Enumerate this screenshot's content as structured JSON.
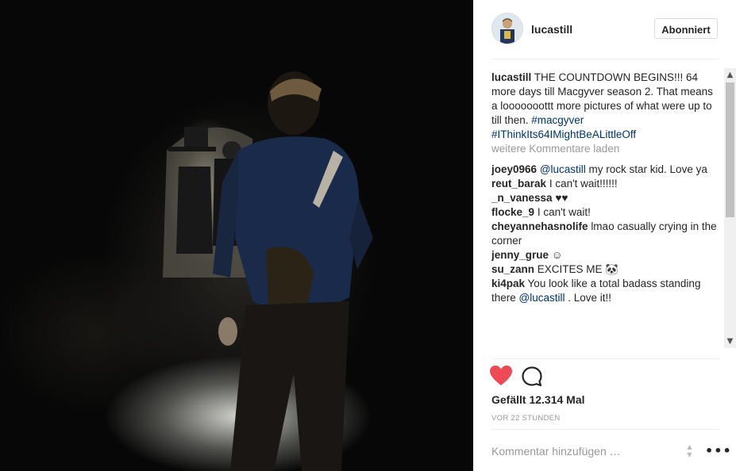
{
  "post": {
    "image_alt": "Man in blue shirt with shoulder bag standing in a dark tunnel facing a film crew"
  },
  "header": {
    "username": "lucastill",
    "follow_label": "Abonniert"
  },
  "caption": {
    "username": "lucastill",
    "text": "THE COUNTDOWN BEGINS!!! 64 more days till Macgyver season 2. That means a looooooottt more pictures of what were up to till then. ",
    "hashtags": [
      "#macgyver",
      "#IThinkIts64IMightBeALittleOff"
    ]
  },
  "load_more_label": "weitere Kommentare laden",
  "comments": [
    {
      "user": "joey0966",
      "mention": "@lucastill",
      "text": " my rock star kid. Love ya"
    },
    {
      "user": "reut_barak",
      "text": "I can't wait!!!!!!"
    },
    {
      "user": "_n_vanessa",
      "text": "♥♥"
    },
    {
      "user": "flocke_9",
      "text": "I can't wait!"
    },
    {
      "user": "cheyannehasnolife",
      "text": "lmao casually crying in the corner"
    },
    {
      "user": "jenny_grue",
      "text": "☺"
    },
    {
      "user": "su_zann",
      "text": "EXCITES ME 🐼"
    },
    {
      "user": "ki4pak",
      "text": "You look like a total badass standing there ",
      "mention": "@lucastill",
      "text2": " . Love it!!"
    }
  ],
  "actions": {
    "like_icon": "heart-icon",
    "comment_icon": "comment-bubble-icon",
    "like_color": "#ed4956"
  },
  "likes_text": "Gefällt 12.314 Mal",
  "timestamp": "VOR 22 STUNDEN",
  "comment_box": {
    "placeholder": "Kommentar hinzufügen …",
    "more_label": "•••"
  },
  "colors": {
    "link": "#003569",
    "muted": "#999999",
    "text": "#262626"
  }
}
